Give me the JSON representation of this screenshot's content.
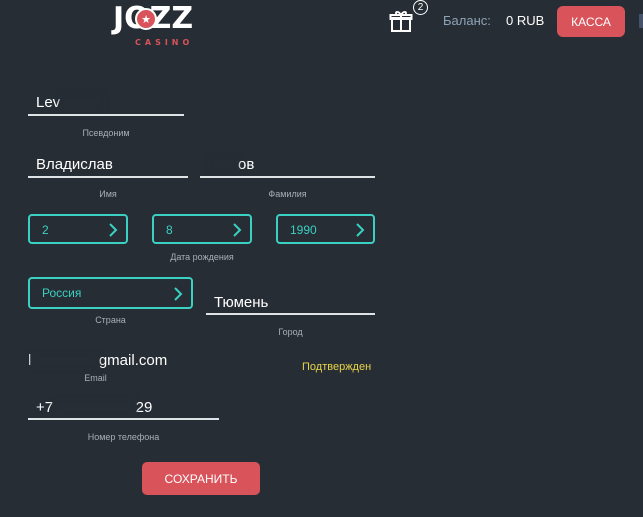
{
  "header": {
    "logo_text": "JOZZ",
    "logo_subtext": "CASINO",
    "gift_count": "2",
    "balance_label": "Баланс:",
    "balance_value": "0 RUB",
    "cashier_button": "КАССА"
  },
  "profile": {
    "nickname": {
      "value_visible": "Lev",
      "caption": "Псевдоним"
    },
    "first_name": {
      "value": "Владислав",
      "caption": "Имя"
    },
    "last_name": {
      "value_visible": "ов",
      "caption": "Фамилия"
    },
    "birth_date": {
      "caption": "Дата рождения",
      "day": "2",
      "month": "8",
      "year": "1990"
    },
    "country": {
      "value": "Россия",
      "caption": "Страна"
    },
    "city": {
      "value": "Тюмень",
      "caption": "Город"
    },
    "email": {
      "prefix_visible": "l",
      "suffix_visible": "gmail.com",
      "caption": "Email",
      "status": "Подтвержден"
    },
    "phone": {
      "prefix_visible": "+7",
      "suffix_visible": "29",
      "caption": "Номер телефона"
    },
    "save_button": "СОХРАНИТЬ"
  },
  "colors": {
    "background": "#262d34",
    "accent_red": "#d9535b",
    "accent_teal": "#3ad1c2",
    "confirmed_yellow": "#e9d44a"
  },
  "icons": {
    "gift": "gift-icon",
    "chevron": "chevron-right-icon"
  }
}
